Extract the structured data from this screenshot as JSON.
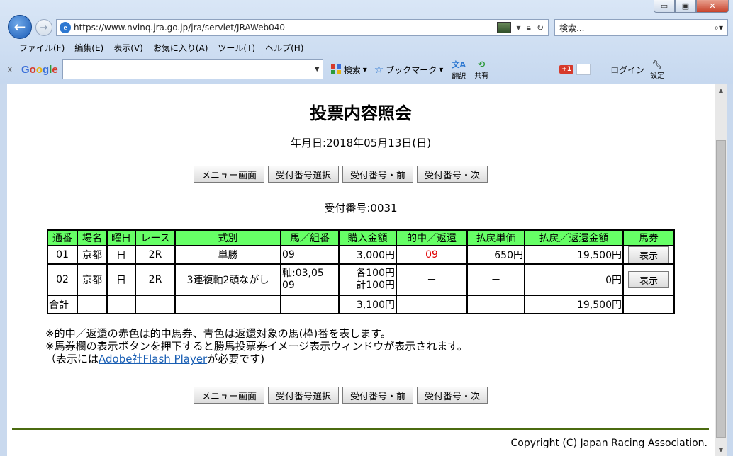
{
  "browser": {
    "url": "https://www.nvinq.jra.go.jp/jra/servlet/JRAWeb040",
    "search_placeholder": "検索...",
    "window_buttons": {
      "minimize": "▭",
      "restore": "▣",
      "close": "✕"
    },
    "menu": [
      "ファイル(F)",
      "編集(E)",
      "表示(V)",
      "お気に入り(A)",
      "ツール(T)",
      "ヘルプ(H)"
    ],
    "google_toolbar": {
      "close": "x",
      "search_label": "検索",
      "bookmark_label": "ブックマーク",
      "translate_label": "翻訳",
      "share_label": "共有",
      "gplus": "+1",
      "login_label": "ログイン",
      "settings_label": "設定"
    }
  },
  "page": {
    "title": "投票内容照会",
    "date": "年月日:2018年05月13日(日)",
    "buttons": [
      "メニュー画面",
      "受付番号選択",
      "受付番号・前",
      "受付番号・次"
    ],
    "receipt_number": "受付番号:0031",
    "table": {
      "headers": [
        "通番",
        "場名",
        "曜日",
        "レース",
        "式別",
        "馬／組番",
        "購入金額",
        "的中／返還",
        "払戻単価",
        "払戻／返還金額",
        "馬券"
      ],
      "rows": [
        {
          "no": "01",
          "venue": "京都",
          "day": "日",
          "race": "2R",
          "type": "単勝",
          "combo_1": "09",
          "combo_2": "",
          "amount_1": "3,000円",
          "amount_2": "",
          "hit": "09",
          "unit": "650円",
          "payout": "19,500円",
          "ticket": "表示"
        },
        {
          "no": "02",
          "venue": "京都",
          "day": "日",
          "race": "2R",
          "type": "3連複軸2頭ながし",
          "combo_1": "軸:03,05",
          "combo_2": "09",
          "amount_1": "各100円",
          "amount_2": "計100円",
          "hit": "－",
          "unit": "－",
          "payout": "0円",
          "ticket": "表示"
        }
      ],
      "total": {
        "label": "合計",
        "amount": "3,100円",
        "payout": "19,500円"
      }
    },
    "notes": {
      "line1": "※的中／返還の赤色は的中馬券、青色は返還対象の馬(枠)番を表します。",
      "line2": "※馬券欄の表示ボタンを押下すると勝馬投票券イメージ表示ウィンドウが表示されます。",
      "line3_pre": "（表示には",
      "line3_link": "Adobe社Flash Player",
      "line3_post": "が必要です)"
    },
    "copyright": "Copyright (C) Japan Racing Association."
  },
  "colors": {
    "header_bg": "#66ff66",
    "hit": "#e00000",
    "footer_rule": "#4b6b10",
    "link": "#1a5fb4"
  }
}
